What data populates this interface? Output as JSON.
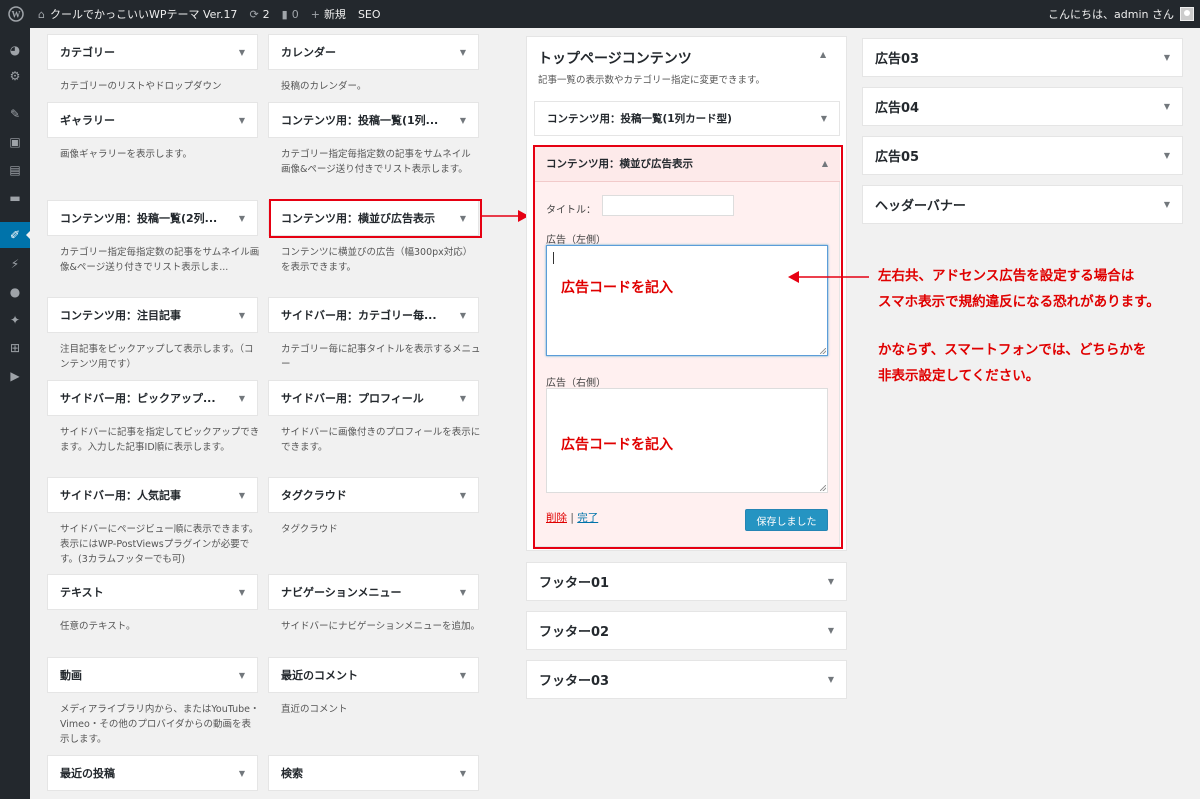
{
  "adminbar": {
    "site_name": "クールでかっこいいWPテーマ Ver.17",
    "updates_count": "2",
    "comments_count": "0",
    "new_label": "新規",
    "seo_label": "SEO",
    "greeting": "こんにちは、admin さん"
  },
  "sidebar": {
    "icons": [
      "dashboard-icon",
      "settings-icon",
      "pin-icon",
      "media-icon",
      "pages-icon",
      "comments-icon",
      "appearance-icon",
      "plugins-icon",
      "users-icon",
      "tools-icon",
      "settings-grid-icon",
      "play-icon"
    ]
  },
  "available_widgets": [
    {
      "title": "カテゴリー",
      "desc": "カテゴリーのリストやドロップダウン"
    },
    {
      "title": "カレンダー",
      "desc": "投稿のカレンダー。"
    },
    {
      "title": "ギャラリー",
      "desc": "画像ギャラリーを表示します。"
    },
    {
      "title": "コンテンツ用：投稿一覧(1列...",
      "desc": "カテゴリー指定毎指定数の記事をサムネイル画像&ページ送り付きでリスト表示します。"
    },
    {
      "title": "コンテンツ用：投稿一覧(2列...",
      "desc": "カテゴリー指定毎指定数の記事をサムネイル画像&ページ送り付きでリスト表示しま..."
    },
    {
      "title": "コンテンツ用：横並び広告表示",
      "desc": "コンテンツに横並びの広告（幅300px対応）を表示できます。"
    },
    {
      "title": "コンテンツ用：注目記事",
      "desc": "注目記事をピックアップして表示します。（コンテンツ用です）"
    },
    {
      "title": "サイドバー用：カテゴリー毎...",
      "desc": "カテゴリー毎に記事タイトルを表示するメニュー"
    },
    {
      "title": "サイドバー用：ピックアップ...",
      "desc": "サイドバーに記事を指定してピックアップできます。入力した記事ID順に表示します。"
    },
    {
      "title": "サイドバー用：プロフィール",
      "desc": "サイドバーに画像付きのプロフィールを表示にできます。"
    },
    {
      "title": "サイドバー用：人気記事",
      "desc": "サイドバーにページビュー順に表示できます。表示にはWP-PostViewsプラグインが必要です。(3カラムフッターでも可)"
    },
    {
      "title": "タグクラウド",
      "desc": "タグクラウド"
    },
    {
      "title": "テキスト",
      "desc": "任意のテキスト。"
    },
    {
      "title": "ナビゲーションメニュー",
      "desc": "サイドバーにナビゲーションメニューを追加。"
    },
    {
      "title": "動画",
      "desc": "メディアライブラリ内から、またはYouTube・Vimeo・その他のプロバイダからの動画を表示します。"
    },
    {
      "title": "最近のコメント",
      "desc": "直近のコメント"
    },
    {
      "title": "最近の投稿",
      "desc": ""
    },
    {
      "title": "検索",
      "desc": ""
    }
  ],
  "top_area": {
    "title": "トップページコンテンツ",
    "desc": "記事一覧の表示数やカテゴリー指定に変更できます。",
    "widget1": "コンテンツ用：投稿一覧(1列カード型)",
    "widget2": "コンテンツ用：横並び広告表示"
  },
  "form": {
    "title_label": "タイトル：",
    "left_label": "広告（左側）",
    "right_label": "広告（右側）",
    "ad_text_left": "広告コードを記入",
    "ad_text_right": "広告コードを記入",
    "delete_label": "削除",
    "separator": "|",
    "done_label": "完了",
    "save_label": "保存しました"
  },
  "middle_areas": [
    "フッター01",
    "フッター02",
    "フッター03"
  ],
  "right_areas": [
    "広告03",
    "広告04",
    "広告05",
    "ヘッダーバナー"
  ],
  "note": {
    "line1": "左右共、アドセンス広告を設定する場合は",
    "line2": "スマホ表示で規約違反になる恐れがあります。",
    "line3": "かならず、スマートフォンでは、どちらかを",
    "line4": "非表示設定してください。"
  },
  "colors": {
    "annotation_red": "#e60012",
    "admin_dark": "#23282d",
    "wp_blue": "#0073aa"
  }
}
